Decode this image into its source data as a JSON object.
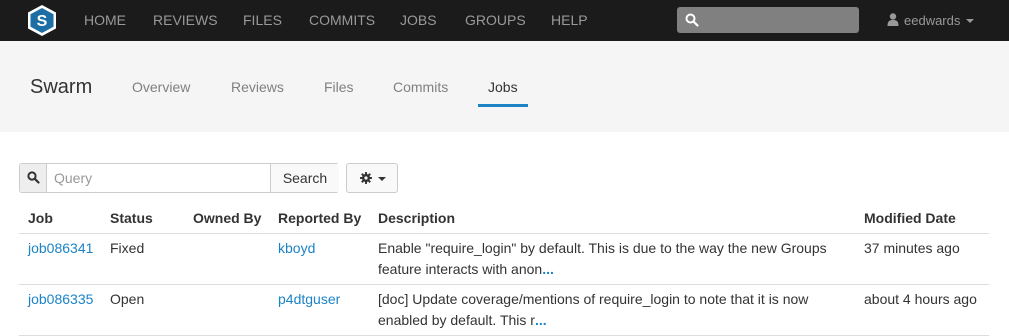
{
  "navbar": {
    "logo_letter": "S",
    "items": [
      "HOME",
      "REVIEWS",
      "FILES",
      "COMMITS",
      "JOBS",
      "GROUPS",
      "HELP"
    ],
    "search_placeholder": "",
    "username": "eedwards"
  },
  "project": {
    "title": "Swarm",
    "tabs": [
      "Overview",
      "Reviews",
      "Files",
      "Commits",
      "Jobs"
    ],
    "active_tab": "Jobs"
  },
  "toolbar": {
    "query_placeholder": "Query",
    "search_label": "Search"
  },
  "table": {
    "headers": [
      "Job",
      "Status",
      "Owned By",
      "Reported By",
      "Description",
      "Modified Date"
    ],
    "rows": [
      {
        "job": "job086341",
        "status": "Fixed",
        "owned_by": "",
        "reported_by": "kboyd",
        "description_line1": "Enable \"require_login\" by default. This is due to the way the new Groups",
        "description_line2": "feature interacts with anon",
        "more": "...",
        "modified": "37 minutes ago"
      },
      {
        "job": "job086335",
        "status": "Open",
        "owned_by": "",
        "reported_by": "p4dtguser",
        "description_line1": "[doc] Update coverage/mentions of require_login to note that it is now",
        "description_line2": "enabled by default. This r",
        "more": "...",
        "modified": "about 4 hours ago"
      }
    ]
  },
  "colors": {
    "navbar_bg": "#1b1b1b",
    "link": "#1c84c6",
    "subheader_bg": "#f5f5f5"
  }
}
